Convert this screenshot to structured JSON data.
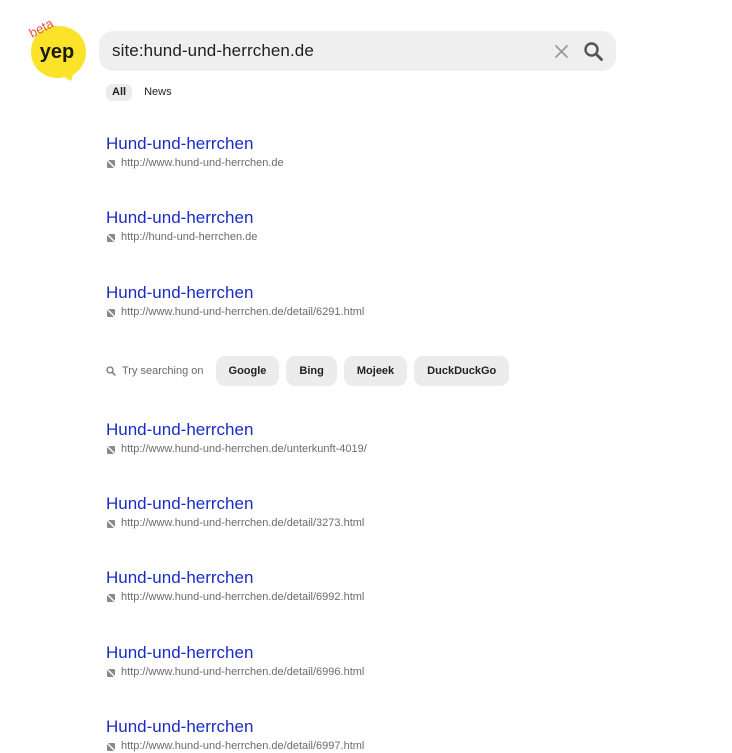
{
  "brand": {
    "logo_text": "yep",
    "badge": "beta",
    "logo_color": "#fbe329",
    "badge_color": "#e8533a"
  },
  "search": {
    "query": "site:hund-und-herrchen.de"
  },
  "tabs": [
    {
      "label": "All",
      "active": true
    },
    {
      "label": "News",
      "active": false
    }
  ],
  "results_top": [
    {
      "title": "Hund-und-herrchen",
      "url": "http://www.hund-und-herrchen.de"
    },
    {
      "title": "Hund-und-herrchen",
      "url": "http://hund-und-herrchen.de"
    },
    {
      "title": "Hund-und-herrchen",
      "url": "http://www.hund-und-herrchen.de/detail/6291.html"
    }
  ],
  "try_searching": {
    "label": "Try searching on",
    "engines": [
      "Google",
      "Bing",
      "Mojeek",
      "DuckDuckGo"
    ]
  },
  "results_bottom": [
    {
      "title": "Hund-und-herrchen",
      "url": "http://www.hund-und-herrchen.de/unterkunft-4019/"
    },
    {
      "title": "Hund-und-herrchen",
      "url": "http://www.hund-und-herrchen.de/detail/3273.html"
    },
    {
      "title": "Hund-und-herrchen",
      "url": "http://www.hund-und-herrchen.de/detail/6992.html"
    },
    {
      "title": "Hund-und-herrchen",
      "url": "http://www.hund-und-herrchen.de/detail/6996.html"
    },
    {
      "title": "Hund-und-herrchen",
      "url": "http://www.hund-und-herrchen.de/detail/6997.html"
    }
  ],
  "colors": {
    "link": "#1a2cc4",
    "url": "#6b6b6b",
    "search_bg": "#efefef",
    "chip_bg": "#ececec"
  }
}
